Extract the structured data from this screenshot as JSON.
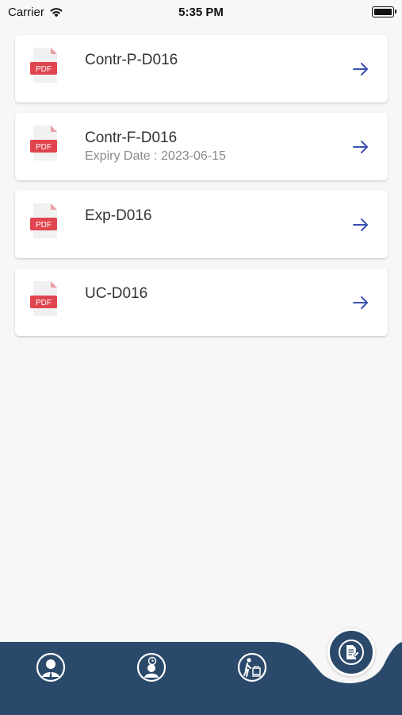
{
  "status_bar": {
    "carrier": "Carrier",
    "time": "5:35 PM"
  },
  "documents": [
    {
      "title": "Contr-P-D016",
      "subtitle": ""
    },
    {
      "title": "Contr-F-D016",
      "subtitle": "Expiry Date : 2023-06-15"
    },
    {
      "title": "Exp-D016",
      "subtitle": ""
    },
    {
      "title": "UC-D016",
      "subtitle": ""
    }
  ],
  "icons": {
    "pdf": "pdf-file-icon",
    "arrow": "arrow-right-icon",
    "nav": [
      "profile-icon",
      "attendance-icon",
      "leave-icon",
      "documents-icon"
    ]
  },
  "pdf_label": "PDF",
  "colors": {
    "nav_bg": "#2b4a6b",
    "arrow": "#3a50b0",
    "pdf_red": "#e0454f",
    "background": "#f7f7f7"
  }
}
